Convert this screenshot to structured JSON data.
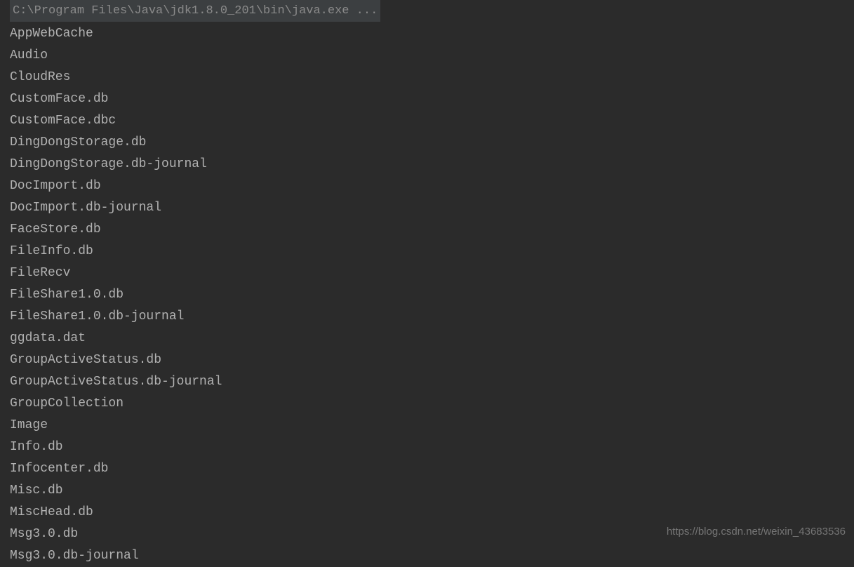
{
  "terminal": {
    "command": " C:\\Program Files\\Java\\jdk1.8.0_201\\bin\\java.exe ...",
    "files": [
      "AppWebCache",
      "Audio",
      "CloudRes",
      "CustomFace.db",
      "CustomFace.dbc",
      "DingDongStorage.db",
      "DingDongStorage.db-journal",
      "DocImport.db",
      "DocImport.db-journal",
      "FaceStore.db",
      "FileInfo.db",
      "FileRecv",
      "FileShare1.0.db",
      "FileShare1.0.db-journal",
      "ggdata.dat",
      "GroupActiveStatus.db",
      "GroupActiveStatus.db-journal",
      "GroupCollection",
      "Image",
      "Info.db",
      "Infocenter.db",
      "Misc.db",
      "MiscHead.db",
      "Msg3.0.db",
      "Msg3.0.db-journal"
    ]
  },
  "watermark": "https://blog.csdn.net/weixin_43683536"
}
